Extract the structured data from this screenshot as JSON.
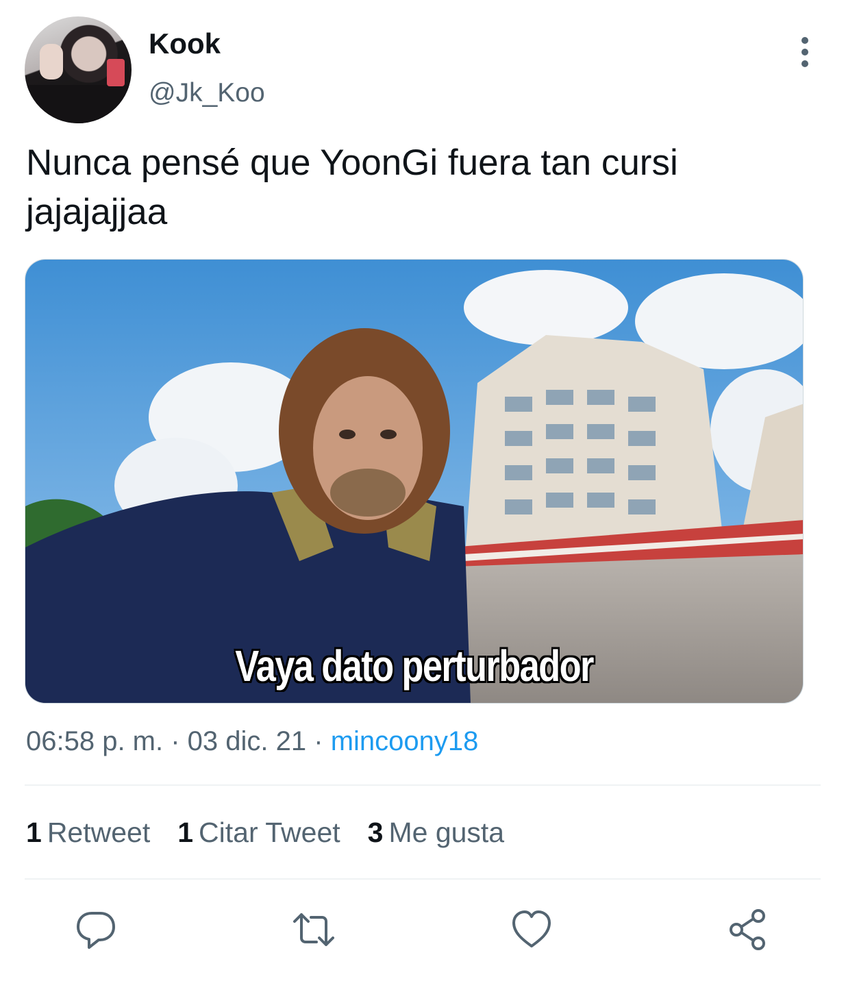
{
  "user": {
    "name": "Kook",
    "handle": "@Jk_Koo"
  },
  "tweet": {
    "text": "Nunca pensé que YoonGi fuera tan cursi jajajajjaa",
    "media_caption": "Vaya dato perturbador"
  },
  "meta": {
    "time": "06:58 p. m.",
    "separator1": " · ",
    "date": "03 dic. 21",
    "separator2": " · ",
    "source": "mincoony18"
  },
  "stats": [
    {
      "count": "1",
      "label": "Retweet"
    },
    {
      "count": "1",
      "label": "Citar Tweet"
    },
    {
      "count": "3",
      "label": "Me gusta"
    }
  ],
  "actions": [
    {
      "icon": "reply-icon"
    },
    {
      "icon": "retweet-icon"
    },
    {
      "icon": "like-icon"
    },
    {
      "icon": "share-icon"
    }
  ],
  "colors": {
    "text_primary": "#0f1419",
    "text_secondary": "#536471",
    "link": "#1d9bf0",
    "divider": "#eff3f4"
  }
}
